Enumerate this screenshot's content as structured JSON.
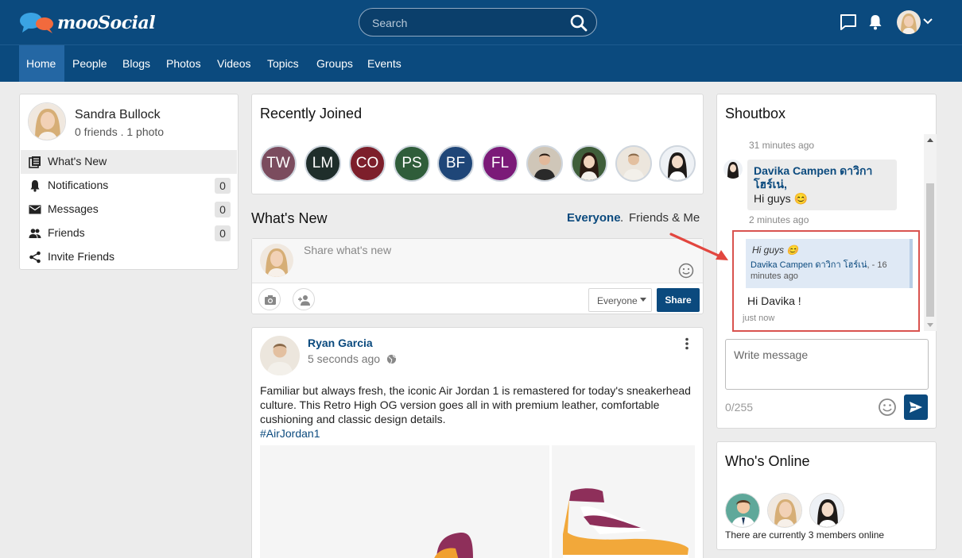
{
  "app": {
    "logo_text": "mooSocial"
  },
  "header": {
    "search_placeholder": "Search"
  },
  "nav": [
    "Home",
    "People",
    "Blogs",
    "Photos",
    "Videos",
    "Topics",
    "Groups",
    "Events"
  ],
  "profile": {
    "name": "Sandra Bullock",
    "stats": "0 friends . 1 photo",
    "menu": [
      {
        "label": "What's New",
        "count": null
      },
      {
        "label": "Notifications",
        "count": "0"
      },
      {
        "label": "Messages",
        "count": "0"
      },
      {
        "label": "Friends",
        "count": "0"
      },
      {
        "label": "Invite Friends",
        "count": null
      }
    ]
  },
  "recently_joined": {
    "title": "Recently Joined",
    "members": [
      {
        "initials": "TW",
        "color": "#7b4c5e"
      },
      {
        "initials": "LM",
        "color": "#1f2e2b"
      },
      {
        "initials": "CO",
        "color": "#7d1f2b"
      },
      {
        "initials": "PS",
        "color": "#2f5d3a"
      },
      {
        "initials": "BF",
        "color": "#1f4678"
      },
      {
        "initials": "FL",
        "color": "#7b1a78"
      }
    ]
  },
  "whats_new": {
    "title": "What's New",
    "filter_everyone": "Everyone",
    "filter_sep": ".",
    "filter_friends": "Friends & Me",
    "composer_placeholder": "Share what's new",
    "privacy": "Everyone",
    "share_label": "Share"
  },
  "post": {
    "author": "Ryan Garcia",
    "time": "5 seconds ago",
    "text": "Familiar but always fresh, the iconic Air Jordan 1 is remastered for today's sneakerhead culture. This Retro High OG version goes all in with premium leather, comfortable cushioning and classic design details.",
    "hashtag": "#AirJordan1"
  },
  "shoutbox": {
    "title": "Shoutbox",
    "time_top": "31 minutes ago",
    "msg_author": "Davika Campen ดาวิกา โฮร์เน่,",
    "msg_text": "Hi guys 😊",
    "msg_time": "2 minutes ago",
    "quote_text": "Hi guys 😊",
    "quote_author": "Davika Campen ดาวิกา โฮร์เน่",
    "quote_time": ", - 16 minutes ago",
    "reply_text": "Hi Davika !",
    "reply_time": "just now",
    "input_placeholder": "Write message",
    "char_count": "0/255"
  },
  "whos_online": {
    "title": "Who's Online",
    "summary": "There are currently 3 members online"
  },
  "colors": {
    "brand": "#0b4a7e",
    "nav_active": "#2467a4",
    "highlight_box": "#d9534f"
  }
}
